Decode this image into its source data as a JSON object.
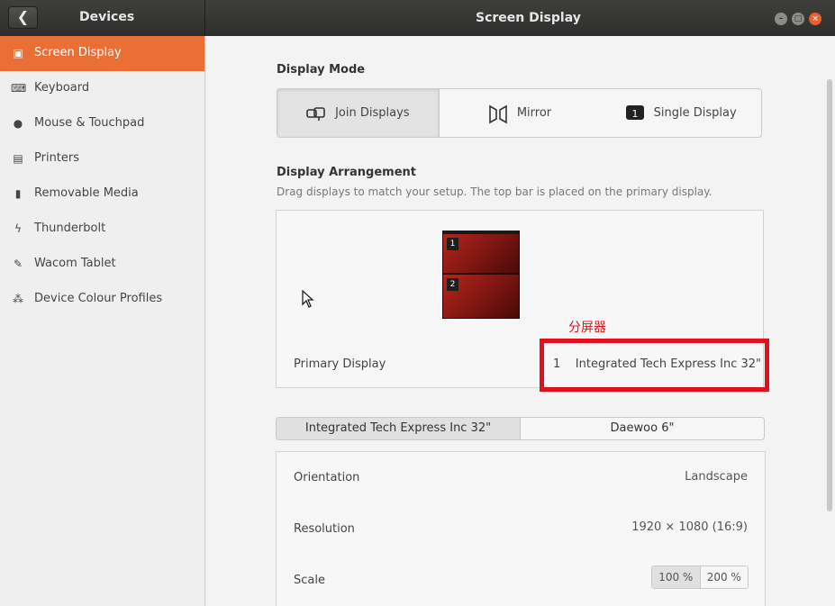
{
  "titlebar": {
    "back_glyph": "❮",
    "devices_title": "Devices",
    "window_title": "Screen Display",
    "minimize_glyph": "–",
    "maximize_glyph": "□",
    "close_glyph": "×"
  },
  "sidebar": {
    "items": [
      {
        "label": "Screen Display",
        "icon": "display-icon",
        "glyph": "▣"
      },
      {
        "label": "Keyboard",
        "icon": "keyboard-icon",
        "glyph": "⌨"
      },
      {
        "label": "Mouse & Touchpad",
        "icon": "mouse-icon",
        "glyph": "●"
      },
      {
        "label": "Printers",
        "icon": "printer-icon",
        "glyph": "▤"
      },
      {
        "label": "Removable Media",
        "icon": "usb-icon",
        "glyph": "▮"
      },
      {
        "label": "Thunderbolt",
        "icon": "thunderbolt-icon",
        "glyph": "ϟ"
      },
      {
        "label": "Wacom Tablet",
        "icon": "tablet-icon",
        "glyph": "✎"
      },
      {
        "label": "Device Colour Profiles",
        "icon": "color-profile-icon",
        "glyph": "⁂"
      }
    ]
  },
  "display_mode": {
    "heading": "Display Mode",
    "options": [
      {
        "label": "Join Displays",
        "icon": "join-displays-icon"
      },
      {
        "label": "Mirror",
        "icon": "mirror-icon"
      },
      {
        "label": "Single Display",
        "icon": "single-display-icon",
        "badge": "1"
      }
    ]
  },
  "arrangement": {
    "heading": "Display Arrangement",
    "description": "Drag displays to match your setup. The top bar is placed on the primary display.",
    "monitors": [
      "1",
      "2"
    ],
    "primary_label": "Primary Display",
    "primary_value": "1    Integrated Tech Express Inc 32\""
  },
  "annotation": {
    "text": "分屏器",
    "color": "#e2101a"
  },
  "display_tabs": [
    "Integrated Tech Express Inc 32\"",
    "Daewoo 6\""
  ],
  "settings": {
    "orientation_label": "Orientation",
    "orientation_value": "Landscape",
    "resolution_label": "Resolution",
    "resolution_value": "1920 × 1080 (16:9)",
    "scale_label": "Scale",
    "scale_options": [
      "100 %",
      "200 %"
    ]
  },
  "colors": {
    "accent": "#e96f37",
    "titlebar": "#343432"
  }
}
